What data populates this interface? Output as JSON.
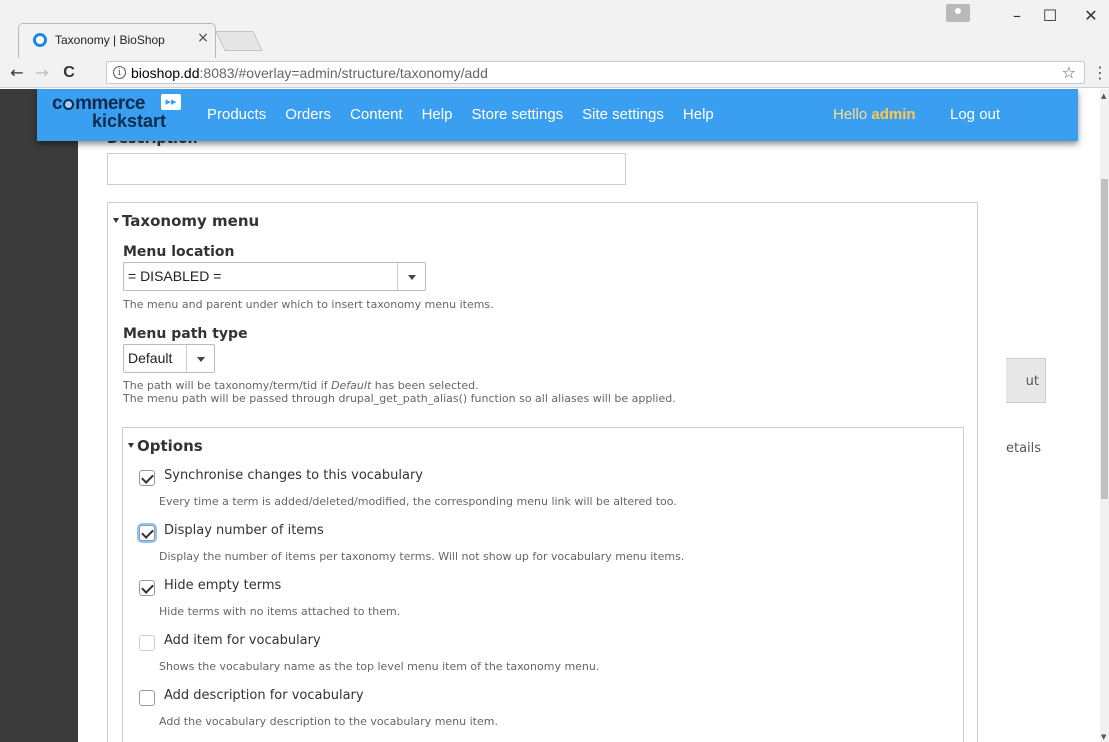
{
  "browser": {
    "tab_title": "Taxonomy | BioShop",
    "tab_close": "×",
    "url_host": "bioshop.dd",
    "url_rest": ":8083/#overlay=admin/structure/taxonomy/add",
    "nav_back": "←",
    "nav_forward": "→",
    "nav_reload": "C",
    "info": "i",
    "star": "☆",
    "menu": "⋮",
    "win_minimize": "–",
    "win_maximize": "☐",
    "win_close": "✕"
  },
  "toolbar": {
    "logo_commerce_a": "c",
    "logo_commerce_b": "mmerce",
    "logo_arrows": "▸▸",
    "logo_kickstart": "kickstart",
    "nav": [
      "Products",
      "Orders",
      "Content",
      "Help",
      "Store settings",
      "Site settings",
      "Help"
    ],
    "hello_prefix": "Hello ",
    "hello_user": "admin",
    "logout": "Log out"
  },
  "background": {
    "button_fragment": "ut",
    "details_fragment": "etails"
  },
  "form": {
    "description_label": "Description",
    "taxonomy_menu": {
      "legend": "Taxonomy menu",
      "menu_location_label": "Menu location",
      "menu_location_value": "= DISABLED =",
      "menu_location_help": "The menu and parent under which to insert taxonomy menu items.",
      "menu_path_type_label": "Menu path type",
      "menu_path_type_value": "Default",
      "path_help_1_a": "The path will be taxonomy/term/tid if ",
      "path_help_1_em": "Default",
      "path_help_1_b": " has been selected.",
      "path_help_2": "The menu path will be passed through drupal_get_path_alias() function so all aliases will be applied."
    },
    "options": {
      "legend": "Options",
      "items": [
        {
          "label": "Synchronise changes to this vocabulary",
          "help": "Every time a term is added/deleted/modified, the corresponding menu link will be altered too.",
          "checked": true
        },
        {
          "label": "Display number of items",
          "help": "Display the number of items per taxonomy terms. Will not show up for vocabulary menu items.",
          "checked": true
        },
        {
          "label": "Hide empty terms",
          "help": "Hide terms with no items attached to them.",
          "checked": true
        },
        {
          "label": "Add item for vocabulary",
          "help": "Shows the vocabulary name as the top level menu item of the taxonomy menu.",
          "checked": false
        },
        {
          "label": "Add description for vocabulary",
          "help": "Add the vocabulary description to the vocabulary menu item.",
          "checked": false
        }
      ]
    }
  }
}
